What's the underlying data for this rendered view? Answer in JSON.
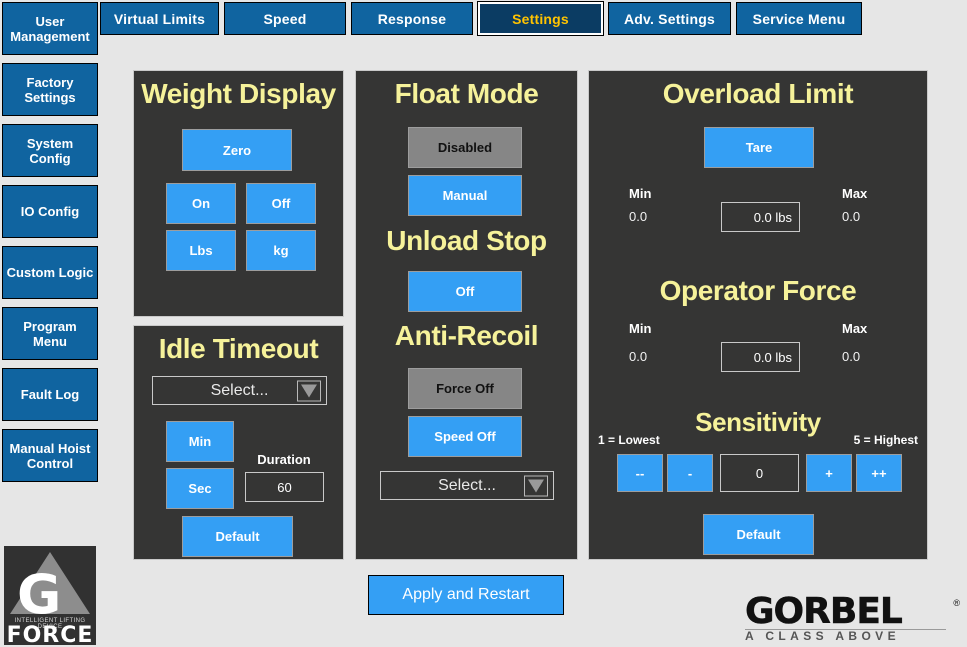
{
  "tabs": [
    {
      "label": "Virtual Limits",
      "active": false
    },
    {
      "label": "Speed",
      "active": false
    },
    {
      "label": "Response",
      "active": false
    },
    {
      "label": "Settings",
      "active": true
    },
    {
      "label": "Adv. Settings",
      "active": false
    },
    {
      "label": "Service Menu",
      "active": false
    }
  ],
  "sidebar": {
    "items": [
      {
        "label": "User Management"
      },
      {
        "label": "Factory Settings"
      },
      {
        "label": "System Config"
      },
      {
        "label": "IO Config"
      },
      {
        "label": "Custom Logic"
      },
      {
        "label": "Program Menu"
      },
      {
        "label": "Fault Log"
      },
      {
        "label": "Manual Hoist Control"
      }
    ]
  },
  "brand_logo": {
    "letter": "G",
    "subtitle": "INTELLIGENT LIFTING DEVICE",
    "word": "FORCE"
  },
  "weight_display": {
    "title": "Weight Display",
    "zero": "Zero",
    "on": "On",
    "off": "Off",
    "lbs": "Lbs",
    "kg": "kg"
  },
  "idle_timeout": {
    "title": "Idle Timeout",
    "select_value": "Select...",
    "min": "Min",
    "sec": "Sec",
    "duration_label": "Duration",
    "duration_value": "60",
    "default": "Default"
  },
  "float_mode": {
    "title": "Float Mode",
    "disabled": "Disabled",
    "manual": "Manual"
  },
  "unload_stop": {
    "title": "Unload Stop",
    "off": "Off"
  },
  "anti_recoil": {
    "title": "Anti-Recoil",
    "force_off": "Force Off",
    "speed_off": "Speed Off",
    "select_value": "Select..."
  },
  "overload_limit": {
    "title": "Overload Limit",
    "tare": "Tare",
    "min_label": "Min",
    "min_value": "0.0",
    "max_label": "Max",
    "max_value": "0.0",
    "field_value": "0.0 lbs"
  },
  "operator_force": {
    "title": "Operator Force",
    "min_label": "Min",
    "min_value": "0.0",
    "max_label": "Max",
    "max_value": "0.0",
    "field_value": "0.0 lbs"
  },
  "sensitivity": {
    "title": "Sensitivity",
    "lowest_label": "1 = Lowest",
    "highest_label": "5 = Highest",
    "dec_double": "--",
    "dec": "-",
    "value": "0",
    "inc": "+",
    "inc_double": "++",
    "default": "Default"
  },
  "apply": {
    "label": "Apply and Restart"
  },
  "gorbel": {
    "name": "GORBEL",
    "registered": "®",
    "tagline": "A CLASS ABOVE"
  },
  "colors": {
    "accent_blue": "#349ff4",
    "nav_blue": "#1064a0",
    "active_tab_blue": "#0b3c63",
    "active_tab_text": "#ffc300",
    "panel_bg": "#353534",
    "panel_title": "#f6f29a",
    "page_bg": "#e6e6e6",
    "disabled_gray": "#868686"
  }
}
